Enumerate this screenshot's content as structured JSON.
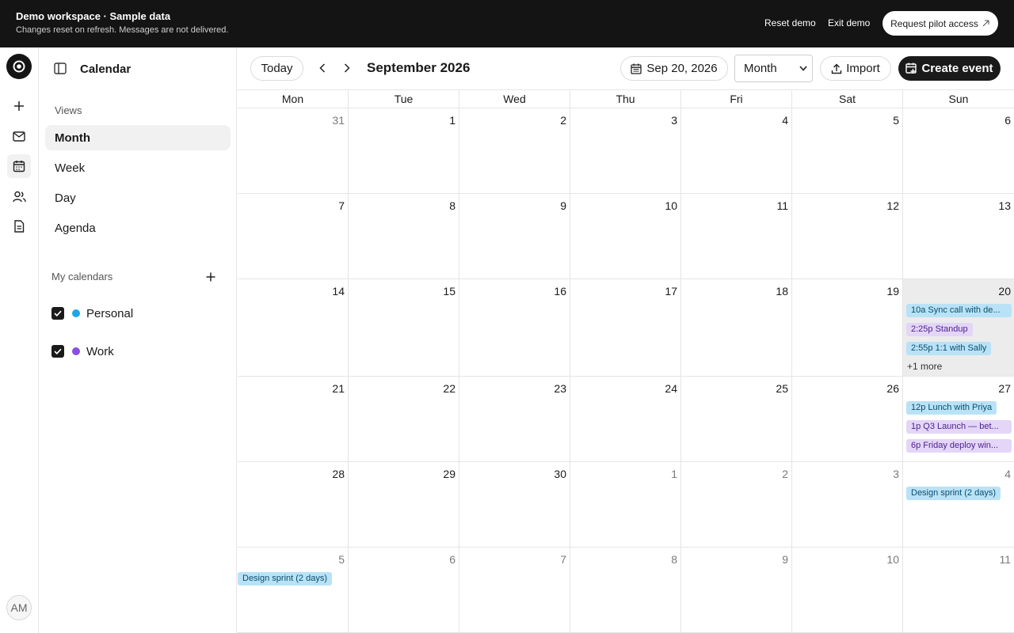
{
  "banner": {
    "title": "Demo workspace · Sample data",
    "subtitle": "Changes reset on refresh. Messages are not delivered.",
    "reset_label": "Reset demo",
    "exit_label": "Exit demo",
    "cta_label": "Request pilot access"
  },
  "rail": {
    "avatar_initials": "AM",
    "icons": [
      "logo-icon",
      "plus-icon",
      "mail-icon",
      "calendar-icon",
      "users-icon",
      "document-icon"
    ]
  },
  "sidebar": {
    "title": "Calendar",
    "views_header": "Views",
    "views": [
      {
        "label": "Month",
        "active": true
      },
      {
        "label": "Week",
        "active": false
      },
      {
        "label": "Day",
        "active": false
      },
      {
        "label": "Agenda",
        "active": false
      }
    ],
    "calendars_header": "My calendars",
    "calendars": [
      {
        "label": "Personal",
        "color": "#1ba7e8",
        "checked": true
      },
      {
        "label": "Work",
        "color": "#8b4ee0",
        "checked": true
      }
    ]
  },
  "toolbar": {
    "today_label": "Today",
    "month_label": "September 2026",
    "date_label": "Sep 20, 2026",
    "view_select": "Month",
    "import_label": "Import",
    "create_label": "Create event"
  },
  "colors": {
    "personal": "#b9e2f6",
    "work": "#e3d6f7",
    "banner_bg": "#141414",
    "today_bg": "#ececec"
  },
  "calendar": {
    "weekdays": [
      "Mon",
      "Tue",
      "Wed",
      "Thu",
      "Fri",
      "Sat",
      "Sun"
    ],
    "weeks": [
      {
        "days": [
          {
            "n": "31",
            "muted": true
          },
          {
            "n": "1"
          },
          {
            "n": "2"
          },
          {
            "n": "3"
          },
          {
            "n": "4"
          },
          {
            "n": "5"
          },
          {
            "n": "6"
          }
        ]
      },
      {
        "days": [
          {
            "n": "7"
          },
          {
            "n": "8"
          },
          {
            "n": "9"
          },
          {
            "n": "10"
          },
          {
            "n": "11"
          },
          {
            "n": "12"
          },
          {
            "n": "13"
          }
        ]
      },
      {
        "days": [
          {
            "n": "14"
          },
          {
            "n": "15"
          },
          {
            "n": "16"
          },
          {
            "n": "17"
          },
          {
            "n": "18"
          },
          {
            "n": "19"
          },
          {
            "n": "20",
            "today": true,
            "events": [
              {
                "label": "10a Sync call with de...",
                "cal": "personal"
              },
              {
                "label": "2:25p Standup",
                "cal": "work",
                "short": true
              },
              {
                "label": "2:55p 1:1 with Sally",
                "cal": "personal",
                "short": true
              }
            ],
            "more": "+1 more"
          }
        ]
      },
      {
        "days": [
          {
            "n": "21"
          },
          {
            "n": "22"
          },
          {
            "n": "23"
          },
          {
            "n": "24"
          },
          {
            "n": "25"
          },
          {
            "n": "26"
          },
          {
            "n": "27",
            "events": [
              {
                "label": "12p Lunch with Priya",
                "cal": "personal",
                "short": true
              },
              {
                "label": "1p Q3 Launch — bet...",
                "cal": "work"
              },
              {
                "label": "6p Friday deploy win...",
                "cal": "work"
              }
            ]
          }
        ]
      },
      {
        "days": [
          {
            "n": "28"
          },
          {
            "n": "29"
          },
          {
            "n": "30"
          },
          {
            "n": "1",
            "muted": true
          },
          {
            "n": "2",
            "muted": true
          },
          {
            "n": "3",
            "muted": true
          },
          {
            "n": "4",
            "muted": true,
            "events": [
              {
                "label": "Design sprint (2 days)",
                "cal": "personal",
                "short": true
              }
            ]
          }
        ]
      },
      {
        "days": [
          {
            "n": "5",
            "muted": true,
            "events": [
              {
                "label": "Design sprint (2 days)",
                "cal": "personal",
                "short": true,
                "flush": true
              }
            ]
          },
          {
            "n": "6",
            "muted": true
          },
          {
            "n": "7",
            "muted": true
          },
          {
            "n": "8",
            "muted": true
          },
          {
            "n": "9",
            "muted": true
          },
          {
            "n": "10",
            "muted": true
          },
          {
            "n": "11",
            "muted": true
          }
        ]
      }
    ]
  }
}
